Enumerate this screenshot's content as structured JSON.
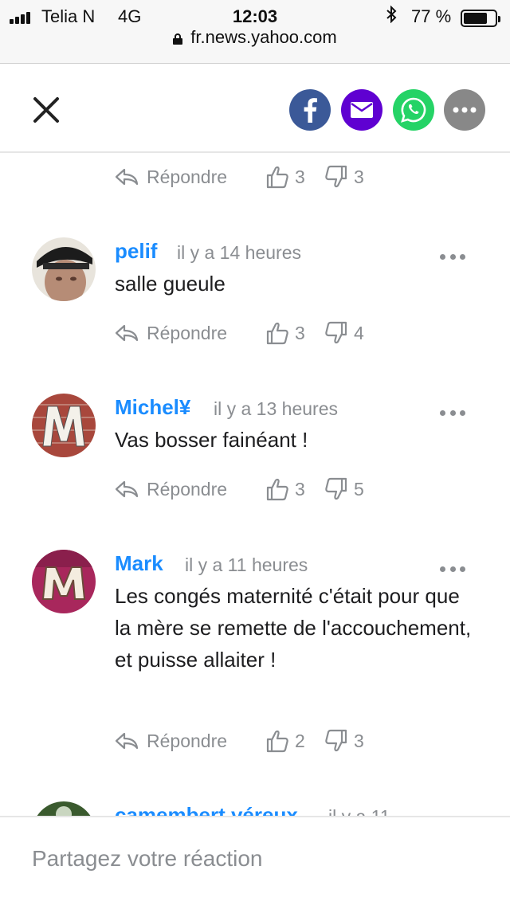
{
  "status_bar": {
    "carrier": "Telia N",
    "network": "4G",
    "time": "12:03",
    "battery": "77 %",
    "battery_level": 0.77,
    "url": "fr.news.yahoo.com"
  },
  "toolbar": {
    "close_icon": "close-icon",
    "share": [
      {
        "name": "facebook",
        "color": "#3b5998"
      },
      {
        "name": "email",
        "color": "#5f01d1"
      },
      {
        "name": "whatsapp",
        "color": "#25d366"
      },
      {
        "name": "more",
        "color": "#888888"
      }
    ]
  },
  "comments": {
    "reply_label": "Répondre",
    "top_partial": {
      "likes": "3",
      "dislikes": "3"
    },
    "items": [
      {
        "author": "pelif",
        "time": "il y a 14 heures",
        "text": "salle gueule",
        "likes": "3",
        "dislikes": "4"
      },
      {
        "author": "Michel¥",
        "time": "il y a 13 heures",
        "text": "Vas bosser fainéant !",
        "likes": "3",
        "dislikes": "5"
      },
      {
        "author": "Mark",
        "time": "il y a 11 heures",
        "text": "Les congés maternité c'était pour que la mère se remette de l'accouchement, et puisse allaiter !",
        "likes": "2",
        "dislikes": "3"
      },
      {
        "author": "camembert véreux",
        "time": "il y a 11"
      }
    ]
  },
  "reaction": {
    "placeholder": "Partagez votre réaction"
  }
}
